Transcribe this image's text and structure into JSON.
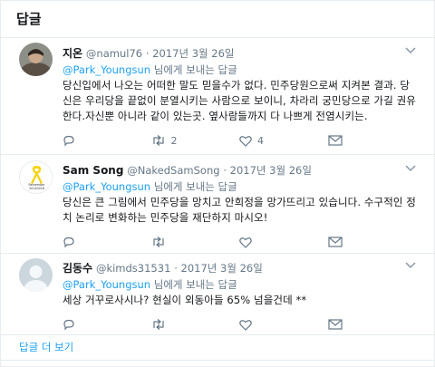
{
  "header": {
    "title": "답글"
  },
  "tweets": [
    {
      "name": "지온",
      "handle": "@namul76",
      "date": "· 2017년 3월 26일",
      "reply_link": "@Park_Youngsun",
      "reply_suffix": " 님에게 보내는 답글",
      "text": "당신입에서 나오는 어떠한 말도 믿을수가 없다. 민주당원으로써 지켜본 결과. 당신은 우리당을 끝없이 분열시키는 사람으로 보이니, 차라리 궁민당으로 가길 권유한다.자신뿐 아니라 같이 있는곳. 옆사람들까지 다 나쁘게 전염시키는.",
      "replies": "",
      "retweets": "2",
      "likes": "4",
      "avatar": "portrait-photo"
    },
    {
      "name": "Sam Song",
      "handle": "@NakedSamSong",
      "date": "· 2017년 3월 26일",
      "reply_link": "@Park_Youngsun",
      "reply_suffix": " 님에게 보내는 답글",
      "text": "당신은 큰 그림에서 민주당을 망치고 안희정을 망가뜨리고 있습니다. 수구적인 정치 논리로 변화하는 민주당을 재단하지 마시오!",
      "replies": "",
      "retweets": "",
      "likes": "",
      "avatar": "yellow-ribbon",
      "avatar_text": "Remember 20140416"
    },
    {
      "name": "김동수",
      "handle": "@kimds31531",
      "date": "· 2017년 3월 26일",
      "reply_link": "@Park_Youngsun",
      "reply_suffix": " 님에게 보내는 답글",
      "text": "세상 거꾸로사시나? 현실이 외동아들 65% 넘을건데 **",
      "replies": "",
      "retweets": "",
      "likes": "",
      "avatar": "default-profile"
    }
  ],
  "footer": {
    "show_more": "답글 더 보기"
  },
  "colors": {
    "accent": "#1da1f2",
    "muted": "#657786",
    "ribbon": "#f5d20b"
  }
}
